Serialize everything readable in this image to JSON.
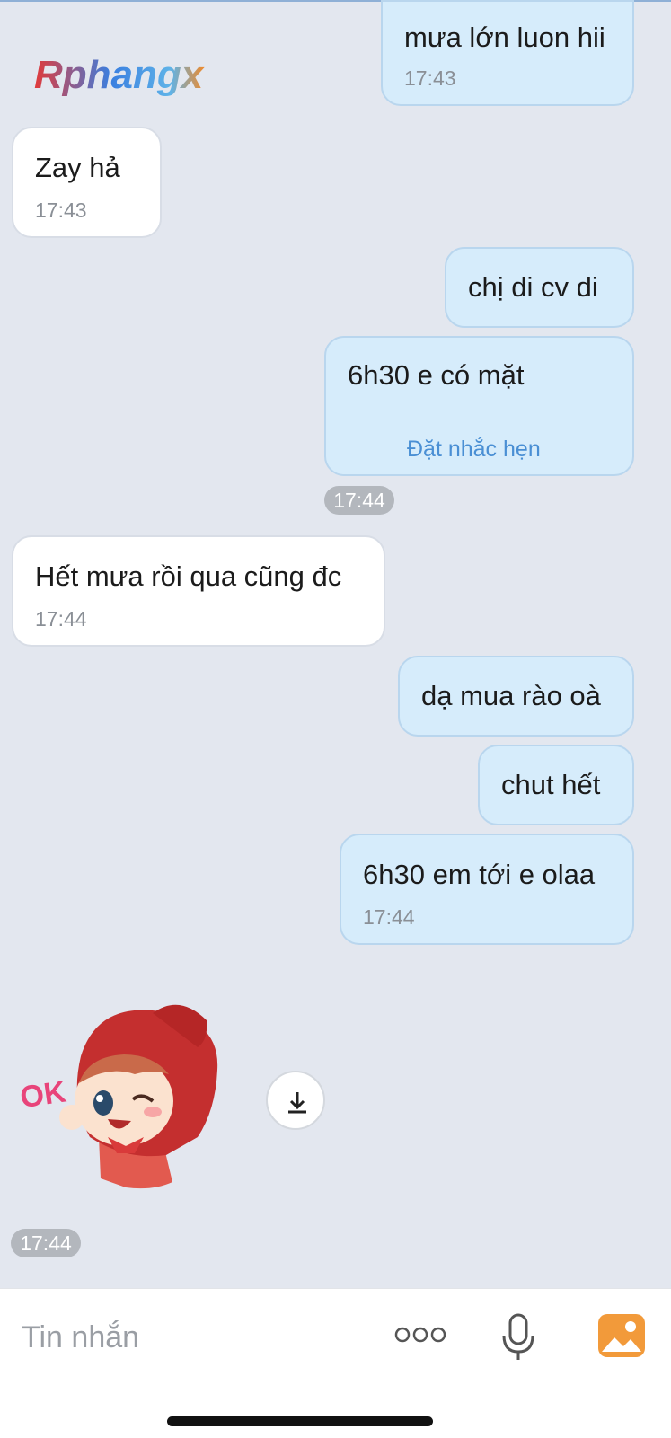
{
  "watermark": {
    "logo_text": "Rphangx"
  },
  "messages": [
    {
      "dir": "out",
      "text": "mưa lớn luon hii",
      "time": "17:43"
    },
    {
      "dir": "in",
      "text": "Zay hả",
      "time": "17:43"
    },
    {
      "dir": "out",
      "text": "chị di cv di"
    },
    {
      "dir": "out",
      "text": "6h30 e có mặt",
      "action": "Đặt nhắc hẹn"
    },
    {
      "dir": "in",
      "text": "Hết mưa rồi qua cũng đc",
      "time": "17:44"
    },
    {
      "dir": "out",
      "text": "dạ mua rào oà"
    },
    {
      "dir": "out",
      "text": "chut hết"
    },
    {
      "dir": "out",
      "text": "6h30 em tới e olaa",
      "time": "17:44"
    }
  ],
  "time_pills": [
    "17:44",
    "17:44"
  ],
  "sticker": {
    "caption_text": "OK"
  },
  "composer": {
    "placeholder": "Tin nhắn"
  },
  "icons": [
    "download-icon",
    "more-dots-icon",
    "microphone-icon",
    "gallery-icon"
  ],
  "colors": {
    "outgoing_bubble": "#d6ecfb",
    "incoming_bubble": "#ffffff",
    "accent": "#f29a3a",
    "link": "#4a8fd4"
  }
}
